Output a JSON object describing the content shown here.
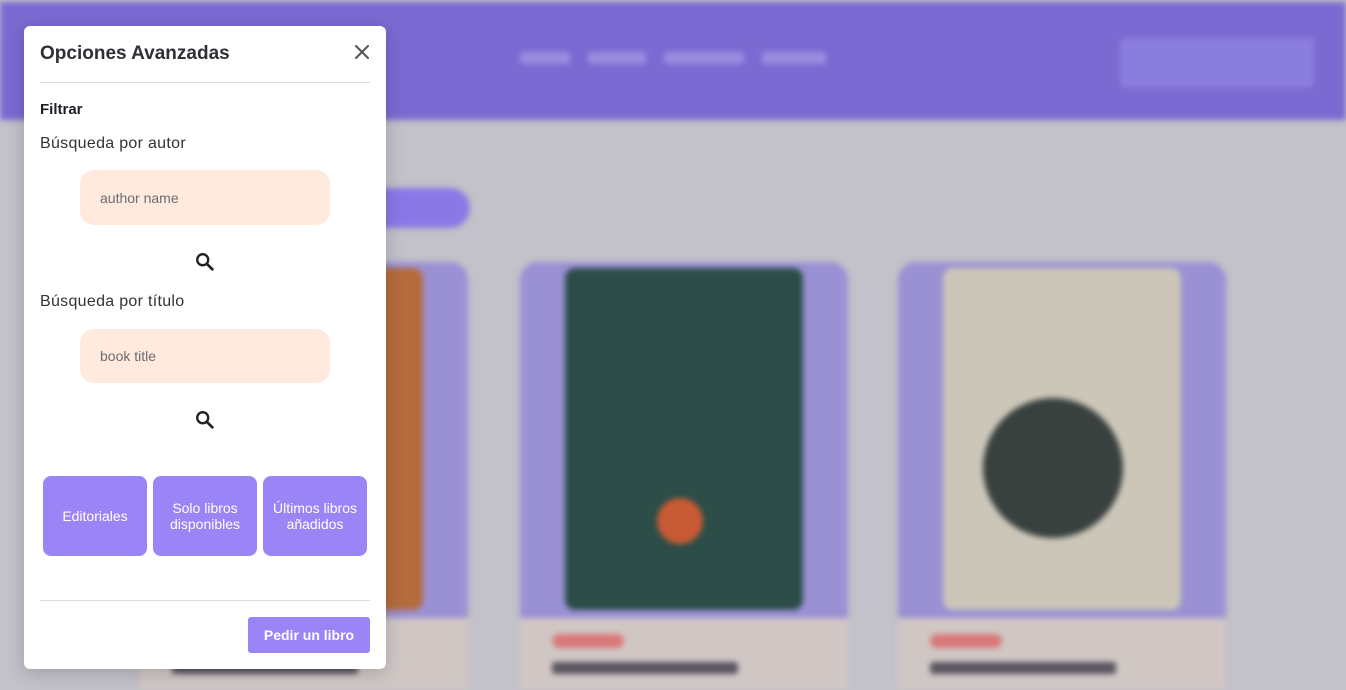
{
  "modal": {
    "title": "Opciones Avanzadas",
    "close_icon": "close-icon",
    "section_label": "Filtrar",
    "author_search": {
      "label": "Búsqueda por autor",
      "placeholder": "author name",
      "value": "",
      "icon": "search-icon"
    },
    "title_search": {
      "label": "Búsqueda por título",
      "placeholder": "book title",
      "value": "",
      "icon": "search-icon"
    },
    "filters": [
      {
        "label": "Editoriales"
      },
      {
        "label": "Solo libros disponibles"
      },
      {
        "label": "Últimos libros añadidos"
      }
    ],
    "request_button": "Pedir un libro"
  },
  "colors": {
    "accent": "#9a84f6",
    "input_bg": "#ffeadd",
    "header_bg": "#7a6ad2"
  }
}
